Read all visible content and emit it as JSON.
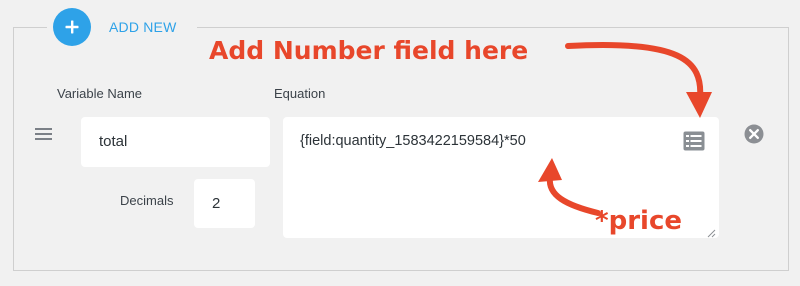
{
  "add_new": {
    "label": "ADD NEW",
    "icon": "plus-icon",
    "color": "#2ea2e8"
  },
  "headers": {
    "variable_name": "Variable Name",
    "equation": "Equation"
  },
  "row": {
    "variable_name_value": "total",
    "decimals_label": "Decimals",
    "decimals_value": "2",
    "equation_value": "{field:quantity_1583422159584}*50",
    "equation_icon": "list-icon",
    "delete_icon": "close-circle-icon",
    "drag_icon": "hamburger-icon"
  },
  "annotations": {
    "add_field": "Add Number field here",
    "price": "*price",
    "color": "#e8472b"
  }
}
